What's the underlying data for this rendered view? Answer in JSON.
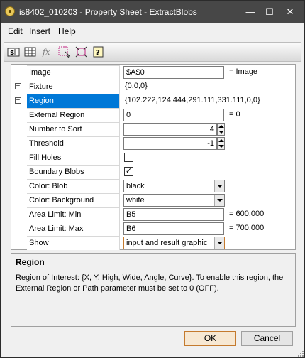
{
  "window": {
    "title": "is8402_010203 - Property Sheet - ExtractBlobs"
  },
  "titlebar": {
    "minimize": "—",
    "maximize": "☐",
    "close": "✕"
  },
  "menu": [
    "Edit",
    "Insert",
    "Help"
  ],
  "toolbar": {
    "icons": [
      "insert-reference-icon",
      "table-icon",
      "function-icon",
      "select-region-icon",
      "fit-region-icon",
      "help-icon"
    ]
  },
  "properties": [
    {
      "label": "Image",
      "expandable": false,
      "kind": "text",
      "value": "$A$0",
      "suffix": "= Image"
    },
    {
      "label": "Fixture",
      "expandable": true,
      "kind": "plain",
      "value": "{0,0,0}"
    },
    {
      "label": "Region",
      "expandable": true,
      "kind": "plain",
      "value": "{102.222,124.444,291.111,331.111,0,0}",
      "selected": true
    },
    {
      "label": "External Region",
      "expandable": false,
      "kind": "text",
      "value": "0",
      "suffix": "= 0"
    },
    {
      "label": "Number to Sort",
      "expandable": false,
      "kind": "spin",
      "value": "4"
    },
    {
      "label": "Threshold",
      "expandable": false,
      "kind": "spin",
      "value": "-1"
    },
    {
      "label": "Fill Holes",
      "expandable": false,
      "kind": "check",
      "checked": false
    },
    {
      "label": "Boundary Blobs",
      "expandable": false,
      "kind": "check",
      "checked": true
    },
    {
      "label": "Color: Blob",
      "expandable": false,
      "kind": "select",
      "value": "black"
    },
    {
      "label": "Color: Background",
      "expandable": false,
      "kind": "select",
      "value": "white"
    },
    {
      "label": "Area Limit: Min",
      "expandable": false,
      "kind": "text",
      "value": "B5",
      "suffix": "= 600.000"
    },
    {
      "label": "Area Limit: Max",
      "expandable": false,
      "kind": "text",
      "value": "B6",
      "suffix": "= 700.000"
    },
    {
      "label": "Show",
      "expandable": false,
      "kind": "select",
      "value": "input and result graphic",
      "highlight": true
    }
  ],
  "help": {
    "title": "Region",
    "text": "Region of Interest: {X, Y, High, Wide, Angle, Curve}. To enable this region, the External Region or Path parameter must be set to 0 (OFF)."
  },
  "buttons": {
    "ok": "OK",
    "cancel": "Cancel"
  },
  "colors": {
    "titlebar": "#474747",
    "selection": "#0078d7",
    "default_button": "#c47a2e"
  }
}
